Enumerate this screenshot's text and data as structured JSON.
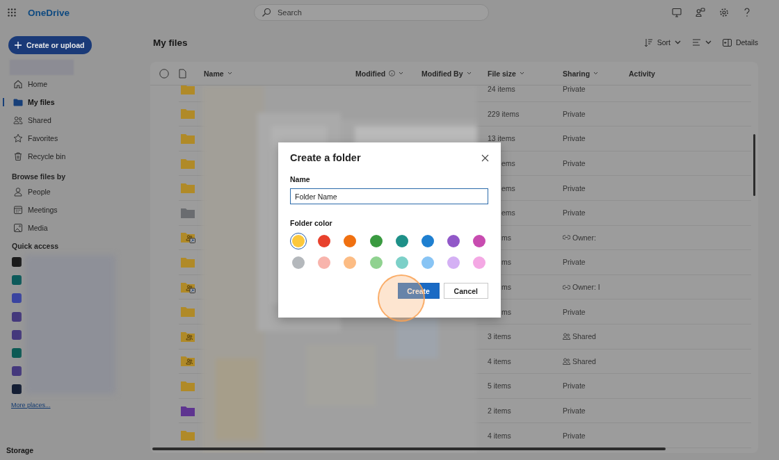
{
  "app": {
    "name": "OneDrive"
  },
  "search": {
    "placeholder": "Search"
  },
  "create_button": "Create or upload",
  "nav": [
    {
      "label": "Home",
      "selected": false
    },
    {
      "label": "My files",
      "selected": true
    },
    {
      "label": "Shared",
      "selected": false
    },
    {
      "label": "Favorites",
      "selected": false
    },
    {
      "label": "Recycle bin",
      "selected": false
    }
  ],
  "browse": {
    "heading": "Browse files by",
    "items": [
      {
        "label": "People"
      },
      {
        "label": "Meetings"
      },
      {
        "label": "Media"
      }
    ]
  },
  "quick_access": {
    "heading": "Quick access",
    "items": [
      {
        "color": "#1a1a1a"
      },
      {
        "color": "#0c5a5a"
      },
      {
        "color": "#3a44a0"
      },
      {
        "color": "#44387c"
      },
      {
        "color": "#44387c"
      },
      {
        "color": "#0c5a54"
      },
      {
        "color": "#44387c"
      },
      {
        "color": "#141e34"
      }
    ]
  },
  "more_places": "More places...",
  "storage": "Storage",
  "page_title": "My files",
  "toolbar": {
    "sort": "Sort",
    "details": "Details"
  },
  "table": {
    "all_selected": false,
    "columns": [
      {
        "label": "Name",
        "sortable": true,
        "info": false
      },
      {
        "label": "Modified",
        "sortable": true,
        "info": true
      },
      {
        "label": "Modified By",
        "sortable": true,
        "info": false
      },
      {
        "label": "File size",
        "sortable": true,
        "info": false
      },
      {
        "label": "Sharing",
        "sortable": true,
        "info": false
      },
      {
        "label": "Activity",
        "sortable": false,
        "info": false
      }
    ],
    "rows": [
      {
        "color": "#b08a28",
        "kind": "private",
        "covered": false,
        "size": "24 items",
        "sharing": "Private"
      },
      {
        "color": "#b08a28",
        "kind": "private",
        "covered": false,
        "size": "229 items",
        "sharing": "Private"
      },
      {
        "color": "#b08a28",
        "kind": "private",
        "covered": false,
        "size": "13 items",
        "sharing": "Private"
      },
      {
        "color": "#b08a28",
        "kind": "private",
        "covered": true,
        "size": "ems",
        "sharing": "Private"
      },
      {
        "color": "#b08a28",
        "kind": "private",
        "covered": true,
        "size": "ems",
        "sharing": "Private"
      },
      {
        "color": "#6a6c70",
        "kind": "private",
        "covered": true,
        "size": "ems",
        "sharing": "Private"
      },
      {
        "color": "#b08a28",
        "kind": "link",
        "covered": true,
        "size": "ms",
        "sharing": "Owner:"
      },
      {
        "color": "#b08a28",
        "kind": "private",
        "covered": true,
        "size": "ms",
        "sharing": "Private"
      },
      {
        "color": "#b08a28",
        "kind": "link",
        "covered": true,
        "size": "ms",
        "sharing": "Owner: I"
      },
      {
        "color": "#b08a28",
        "kind": "private",
        "covered": true,
        "size": "ms",
        "sharing": "Private"
      },
      {
        "color": "#b08a28",
        "kind": "shared",
        "covered": false,
        "size": "3 items",
        "sharing": "Shared"
      },
      {
        "color": "#b08a28",
        "kind": "shared",
        "covered": false,
        "size": "4 items",
        "sharing": "Shared"
      },
      {
        "color": "#b08a28",
        "kind": "private",
        "covered": false,
        "size": "5 items",
        "sharing": "Private"
      },
      {
        "color": "#5e3490",
        "kind": "private",
        "covered": false,
        "size": "2 items",
        "sharing": "Private"
      },
      {
        "color": "#b08a28",
        "kind": "private",
        "covered": false,
        "size": "4 items",
        "sharing": "Private"
      }
    ]
  },
  "dialog": {
    "title": "Create a folder",
    "name_label": "Name",
    "name_value": "Folder Name",
    "color_label": "Folder color",
    "swatches": [
      {
        "color": "#fcc83c",
        "selected": true
      },
      {
        "color": "#e8412c",
        "selected": false
      },
      {
        "color": "#f07010",
        "selected": false
      },
      {
        "color": "#3a9a40",
        "selected": false
      },
      {
        "color": "#1e9088",
        "selected": false
      },
      {
        "color": "#1e7fd0",
        "selected": false
      },
      {
        "color": "#9158c8",
        "selected": false
      },
      {
        "color": "#c84cb0",
        "selected": false
      },
      {
        "color": "#b4b8bc",
        "selected": false
      },
      {
        "color": "#f8b4ac",
        "selected": false
      },
      {
        "color": "#fcbc84",
        "selected": false
      },
      {
        "color": "#90d290",
        "selected": false
      },
      {
        "color": "#7cd0c8",
        "selected": false
      },
      {
        "color": "#88c4f4",
        "selected": false
      },
      {
        "color": "#d4b0f4",
        "selected": false
      },
      {
        "color": "#f4a8e4",
        "selected": false
      }
    ],
    "create": "Create",
    "cancel": "Cancel"
  }
}
